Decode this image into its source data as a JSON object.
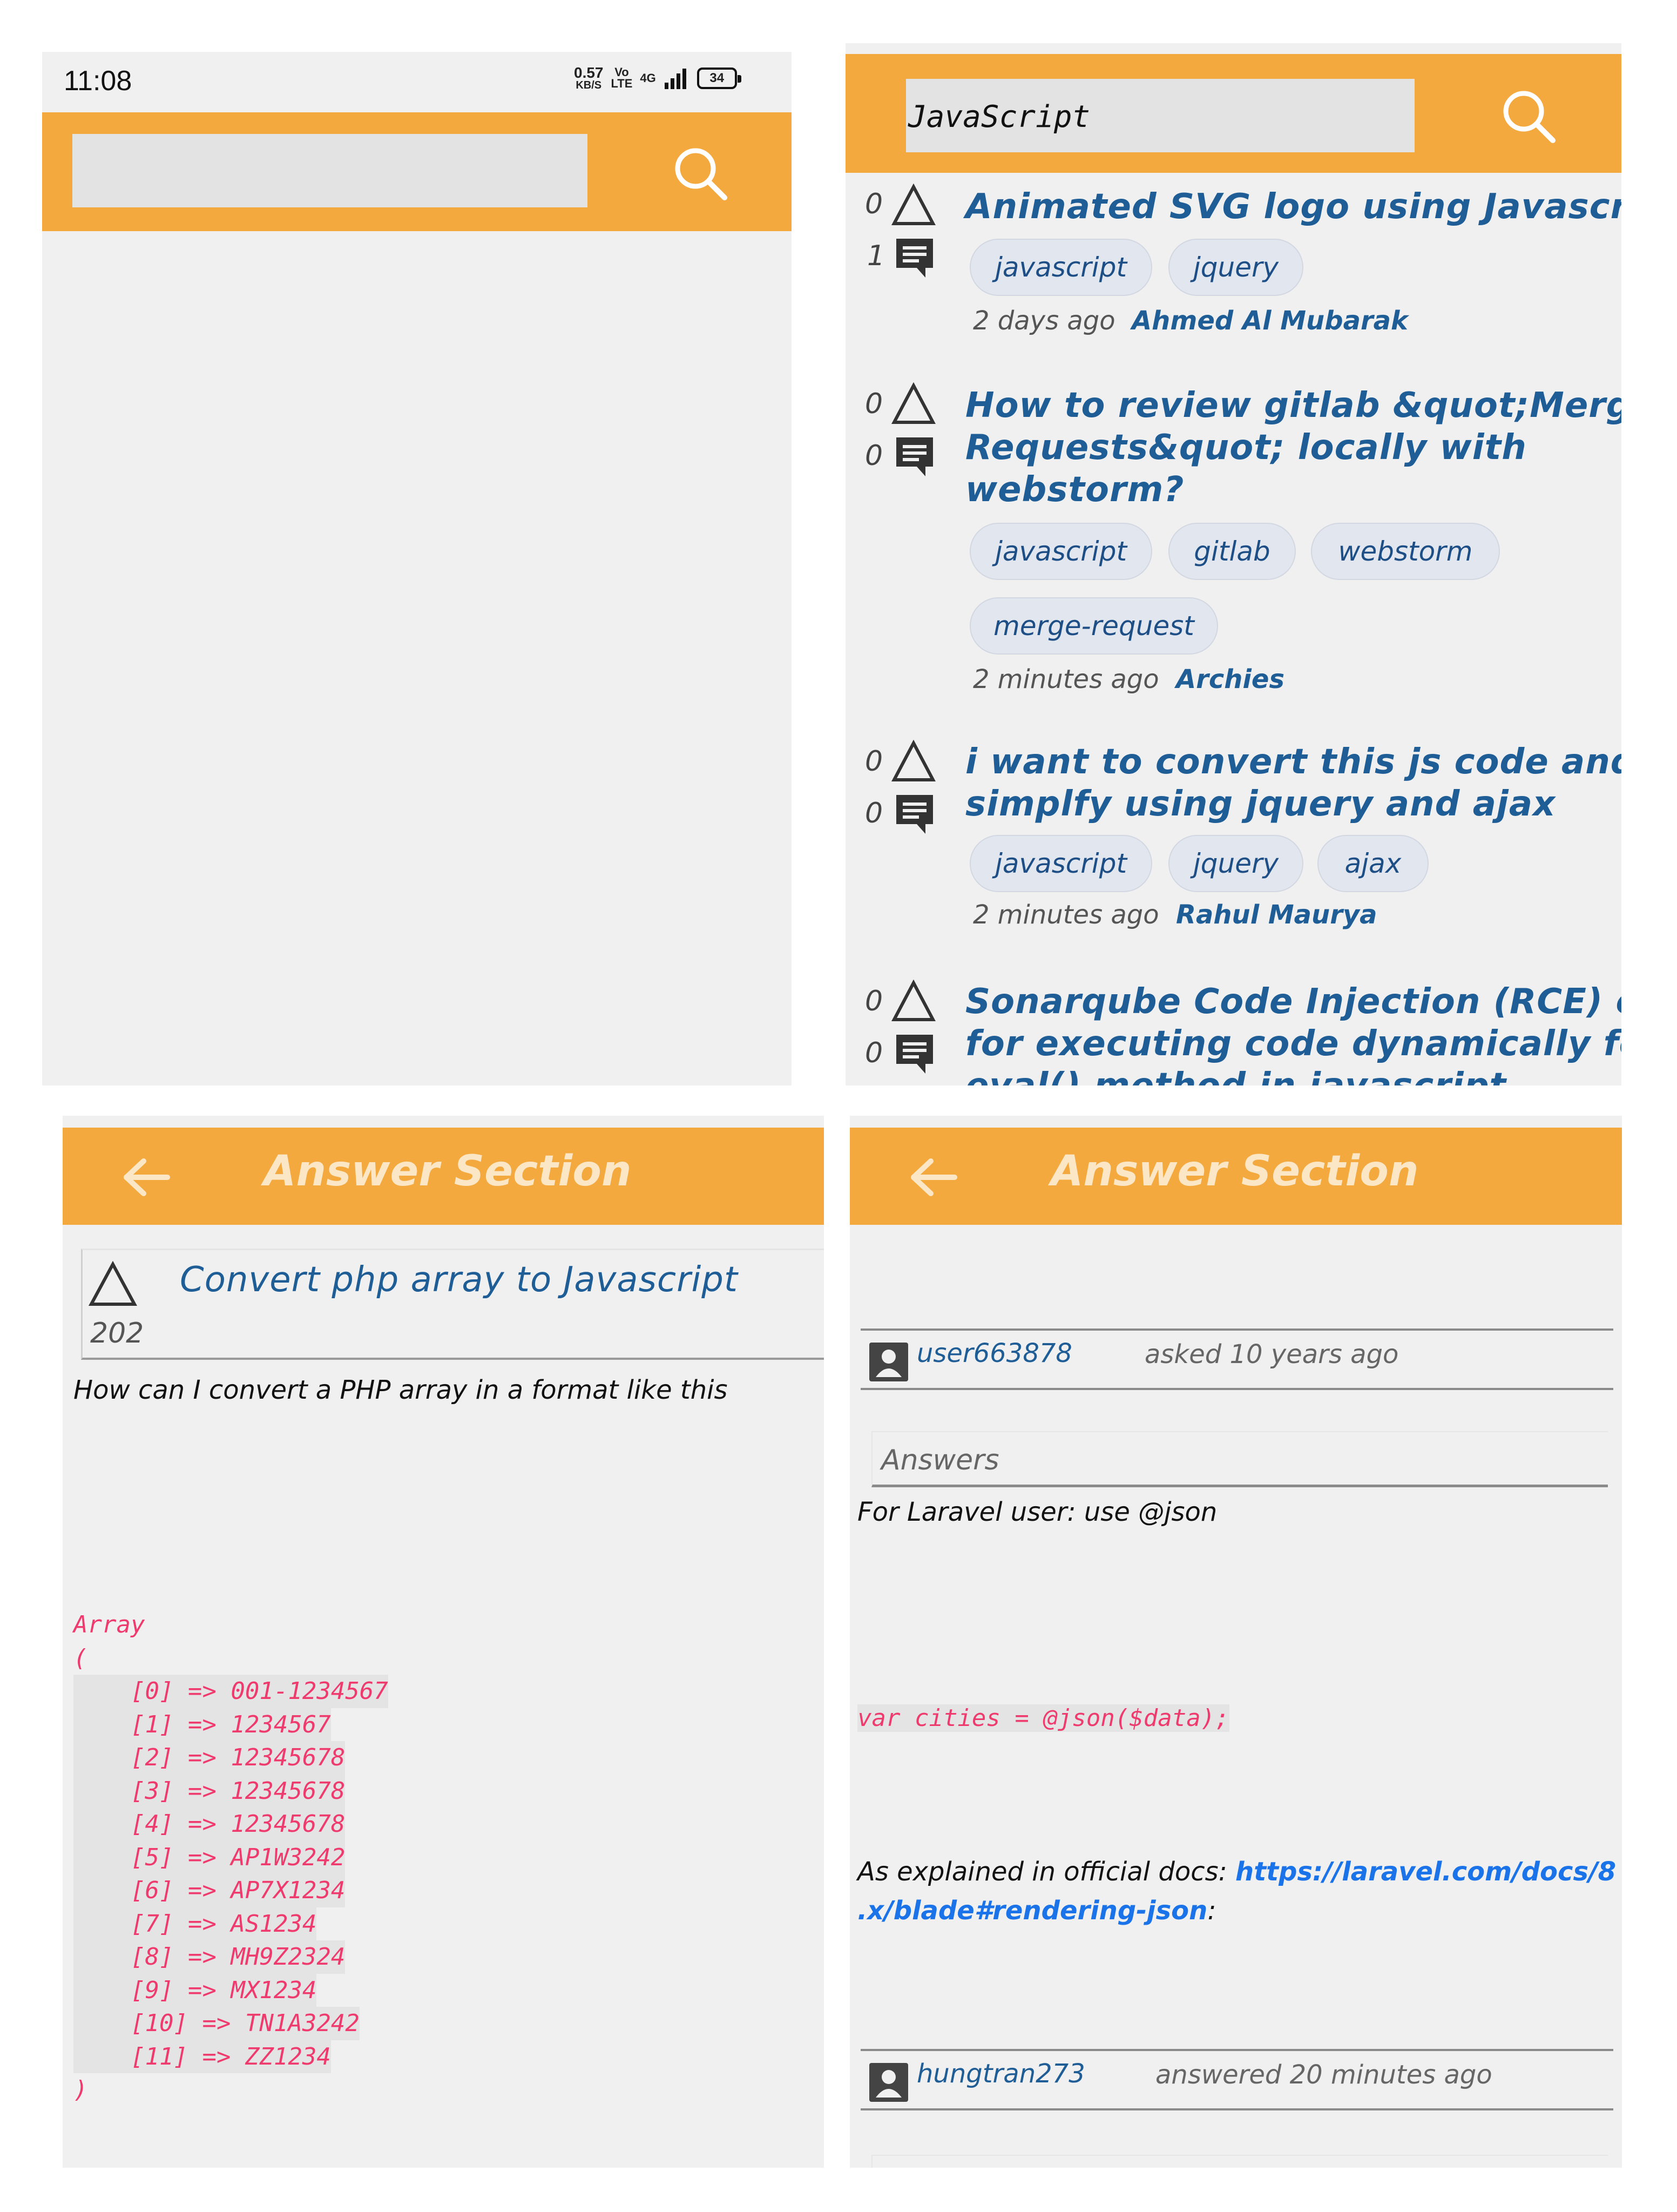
{
  "status_bar": {
    "time": "11:08",
    "speed": "0.57",
    "speed_unit": "KB/S",
    "net1": "Vo",
    "net2": "LTE",
    "net_type": "4G",
    "battery": "34"
  },
  "search_panel": {
    "query": "JavaScript"
  },
  "questions": [
    {
      "votes": "0",
      "answers": "1",
      "title_lines": [
        "Animated SVG logo using Javascript"
      ],
      "tags": [
        "javascript",
        "jquery"
      ],
      "time": "2 days ago",
      "author": "Ahmed Al Mubarak"
    },
    {
      "votes": "0",
      "answers": "0",
      "title_lines": [
        "How to review gitlab &quot;Merge",
        "Requests&quot; locally with",
        "webstorm?"
      ],
      "tags": [
        "javascript",
        "gitlab",
        "webstorm",
        "merge-request"
      ],
      "time": "2 minutes ago",
      "author": "Archies"
    },
    {
      "votes": "0",
      "answers": "0",
      "title_lines": [
        "i want to convert this js code and",
        "simplfy using jquery and ajax"
      ],
      "tags": [
        "javascript",
        "jquery",
        "ajax"
      ],
      "time": "2 minutes ago",
      "author": "Rahul Maurya"
    },
    {
      "votes": "0",
      "answers": "0",
      "title_lines": [
        "Sonarqube Code Injection (RCE) error",
        "for executing code dynamically for",
        "eval() method in javascript"
      ],
      "tags": [],
      "time": "",
      "author": ""
    }
  ],
  "answer_left": {
    "header": "Answer Section",
    "question_title": "Convert php array to Javascript",
    "votes": "202",
    "body": "How can I convert a PHP array in a format like this",
    "code": [
      "Array",
      "(",
      "    [0] => 001-1234567",
      "    [1] => 1234567",
      "    [2] => 12345678",
      "    [3] => 12345678",
      "    [4] => 12345678",
      "    [5] => AP1W3242",
      "    [6] => AP7X1234",
      "    [7] => AS1234",
      "    [8] => MH9Z2324",
      "    [9] => MX1234",
      "    [10] => TN1A3242",
      "    [11] => ZZ1234",
      ")"
    ]
  },
  "answer_right": {
    "header": "Answer Section",
    "asker": "user663878",
    "asked": "asked 10 years ago",
    "answers_label": "Answers",
    "answer_text": "For Laravel user: use @json",
    "answer_code": "var cities = @json($data);",
    "explained": "As explained in official docs: ",
    "link_line1": "https://laravel.com/docs/8",
    "link_line2": ".x/blade#rendering-json",
    "link_suffix": ":",
    "answerer": "hungtran273",
    "answered": "answered 20 minutes ago"
  },
  "colors": {
    "appbar": "#f4a93f",
    "title_blue": "#1e5d96",
    "code_pink": "#ef3a6e",
    "link_blue": "#1a73e8"
  },
  "icons": [
    "search-icon",
    "upvote-icon",
    "comment-icon",
    "back-arrow-icon",
    "user-icon"
  ]
}
